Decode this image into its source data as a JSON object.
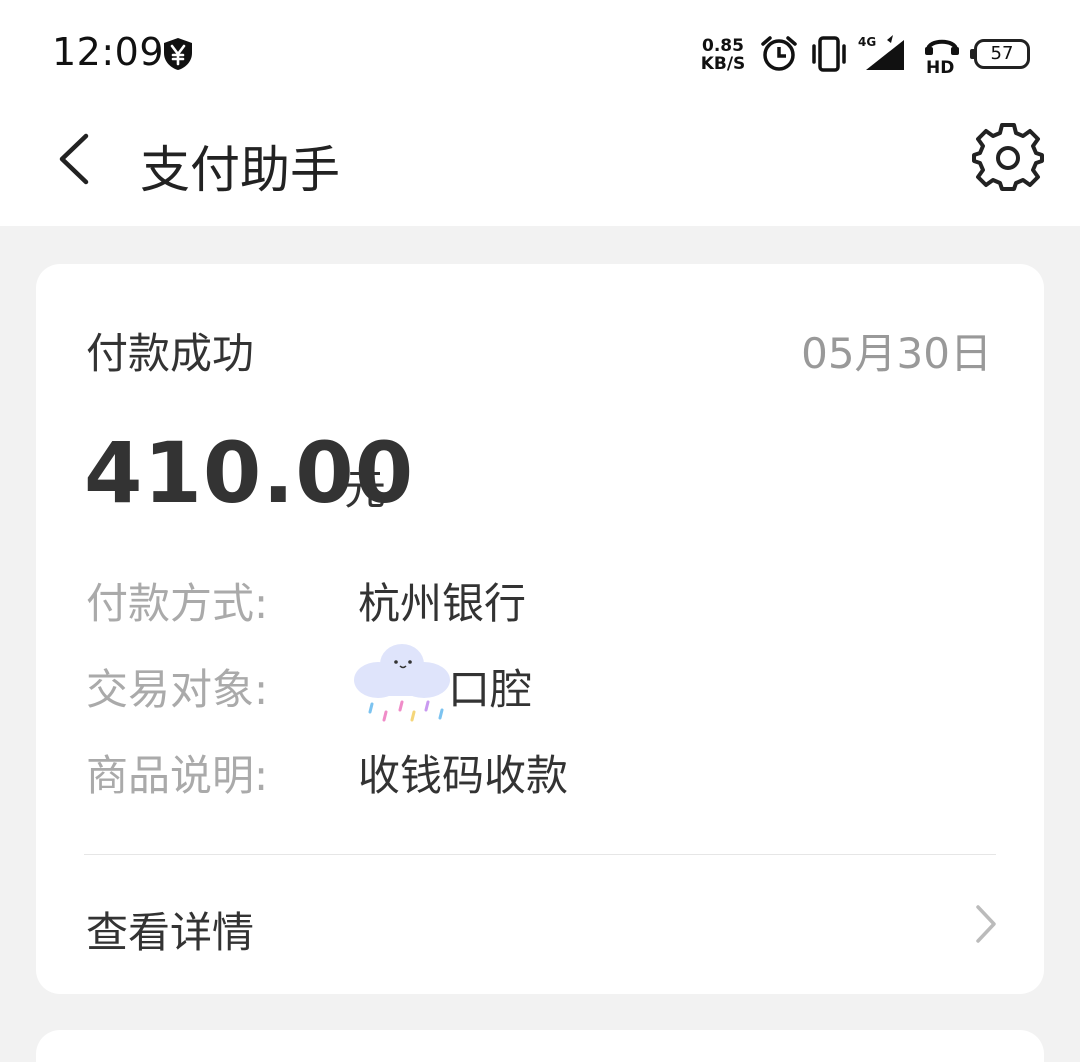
{
  "status_bar": {
    "time": "12:09",
    "net_speed_value": "0.85",
    "net_speed_unit": "KB/S",
    "network_type": "4G",
    "hd_label": "HD",
    "battery_level": "57",
    "icons": [
      "yen-shield-icon",
      "alarm-icon",
      "vibrate-icon",
      "signal-icon",
      "hd-call-icon",
      "battery-icon"
    ]
  },
  "header": {
    "title": "支付助手",
    "back_icon": "chevron-left-icon",
    "settings_icon": "gear-icon"
  },
  "payment_card": {
    "status": "付款成功",
    "date": "05月30日",
    "amount": "410.00",
    "currency": "元",
    "rows": [
      {
        "label": "付款方式:",
        "value": "杭州银行"
      },
      {
        "label": "交易对象:",
        "value": "口腔"
      },
      {
        "label": "商品说明:",
        "value": "收钱码收款"
      }
    ],
    "detail_link": "查看详情"
  },
  "colors": {
    "background": "#f2f2f2",
    "card": "#ffffff",
    "text_primary": "#333333",
    "text_secondary": "#999999",
    "label_gray": "#aaaaaa"
  }
}
